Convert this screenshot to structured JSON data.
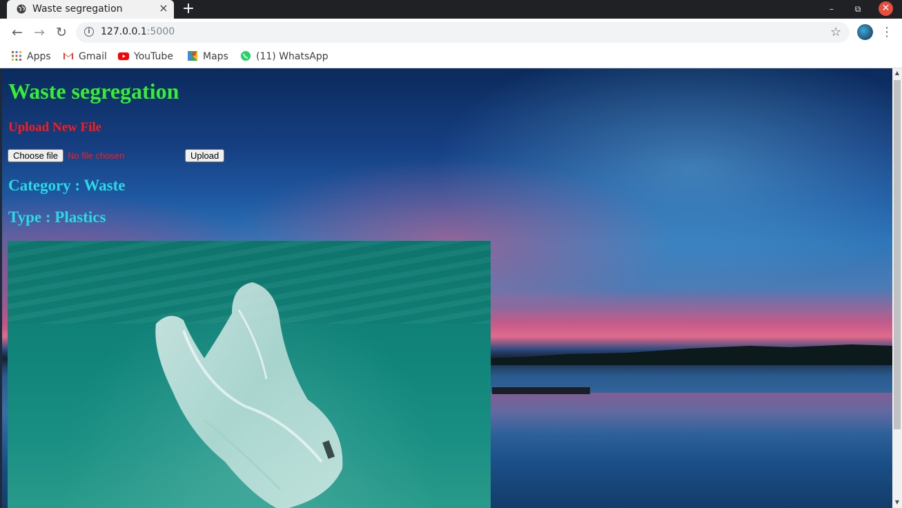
{
  "browser": {
    "tab_title": "Waste segregation",
    "new_tab_symbol": "+",
    "close_tab_symbol": "×",
    "url_host": "127.0.0.1",
    "url_port": ":5000",
    "bookmarks": [
      {
        "label": "Apps",
        "icon": "apps-grid-icon"
      },
      {
        "label": "Gmail",
        "icon": "gmail-icon"
      },
      {
        "label": "YouTube",
        "icon": "youtube-icon"
      },
      {
        "label": "Maps",
        "icon": "maps-icon"
      },
      {
        "label": "(11) WhatsApp",
        "icon": "whatsapp-icon"
      }
    ]
  },
  "page": {
    "title": "Waste segregation",
    "upload_heading": "Upload New File",
    "choose_file_label": "Choose file",
    "file_status": "No file chosen",
    "upload_label": "Upload",
    "category_text": "Category : Waste",
    "type_text": "Type : Plastics"
  },
  "colors": {
    "title": "#33ee33",
    "upload_heading": "#ff1a1a",
    "result_text": "#2ad9e6",
    "window_close": "#e94e3c"
  }
}
